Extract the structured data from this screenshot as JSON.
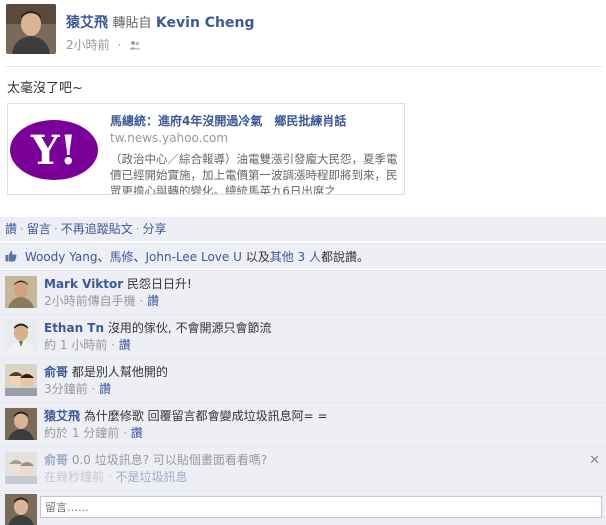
{
  "post": {
    "author": "猿艾飛",
    "shared_from_label": "轉貼自",
    "shared_from": "Kevin Cheng",
    "time": "2小時前",
    "message": "太毫沒了吧~"
  },
  "link_share": {
    "title": "馬總統：進府4年沒開過冷氣　鄉民批練肖話",
    "domain": "tw.news.yahoo.com",
    "description": "（政治中心／綜合報導）油電雙漲引發龐大民怨，夏季電價已經開始實施，加上電價第一波調漲時程即將到來，民眾更擔心與轉的變化。總統馬英九6日出席之"
  },
  "actions": {
    "like": "讚",
    "comment": "留言",
    "unfollow": "不再追蹤貼文",
    "share": "分享",
    "separator": "·"
  },
  "likes": {
    "people": [
      "Woody Yang",
      "馬修",
      "John-Lee Love U"
    ],
    "sep1": "、",
    "sep2": "、",
    "and_text": " 以及",
    "others_link": "其他 3 人",
    "tail": "都說讚。"
  },
  "comments": [
    {
      "name": "Mark Viktor",
      "text": "民怨日日升!",
      "meta": "2小時前傳自手機",
      "like": "讚",
      "faded": false
    },
    {
      "name": "Ethan Tn",
      "text": "沒用的傢伙, 不會開源只會節流",
      "meta": "約 1 小時前",
      "like": "讚",
      "faded": false
    },
    {
      "name": "俞哥",
      "text": "都是別人幫他開的",
      "meta": "3分鐘前",
      "like": "讚",
      "faded": false
    },
    {
      "name": "猿艾飛",
      "text": "為什麼修歌 回覆留言都會變成垃圾訊息阿= =",
      "meta": "約於 1 分鐘前",
      "like": "讚",
      "faded": false
    },
    {
      "name": "俞哥",
      "text": "0.0 垃圾訊息? 可以貼個畫面看看嗎?",
      "meta": "在幾秒鐘前",
      "not_spam": "不是垃圾訊息",
      "faded": true,
      "close": "✕"
    }
  ],
  "composer": {
    "placeholder": "留言……"
  },
  "colors": {
    "link_blue": "#3b5998",
    "panel_bg": "#edeff4",
    "yahoo_purple": "#7b0099"
  }
}
